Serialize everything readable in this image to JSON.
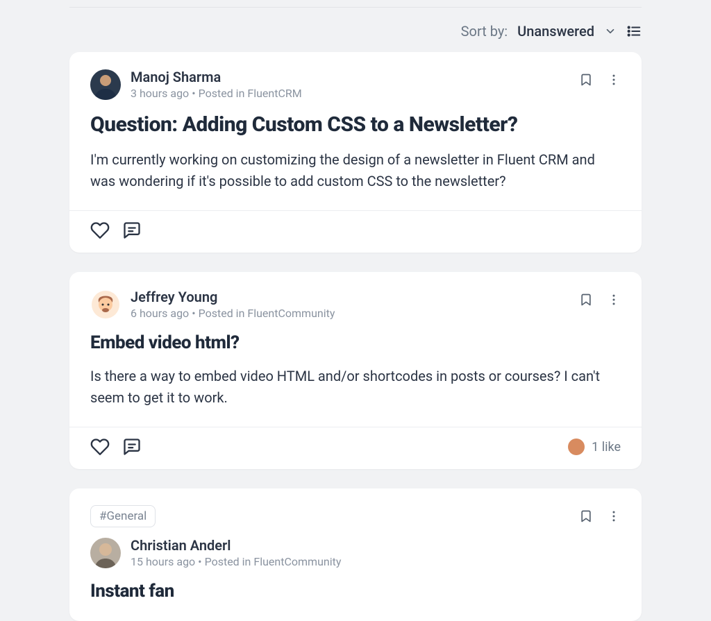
{
  "toolbar": {
    "sort_label": "Sort by:",
    "sort_value": "Unanswered"
  },
  "posts": [
    {
      "author": "Manoj Sharma",
      "time": "3 hours ago",
      "posted_in_prefix": "Posted in",
      "posted_in": "FluentCRM",
      "title": "Question: Adding Custom CSS to a Newsletter?",
      "body": " I'm currently working on customizing the design of a newsletter in Fluent CRM and was wondering if it's possible to add custom CSS to the newsletter?",
      "likes_label": ""
    },
    {
      "author": "Jeffrey Young",
      "time": "6 hours ago",
      "posted_in_prefix": "Posted in",
      "posted_in": "FluentCommunity",
      "title": "Embed video html?",
      "body": "Is there a way to embed video HTML and/or shortcodes in posts or courses? I can't seem to get it to work.",
      "likes_label": "1 like"
    },
    {
      "tag": "#General",
      "author": "Christian Anderl",
      "time": "15 hours ago",
      "posted_in_prefix": "Posted in",
      "posted_in": "FluentCommunity",
      "title": "Instant fan"
    }
  ]
}
